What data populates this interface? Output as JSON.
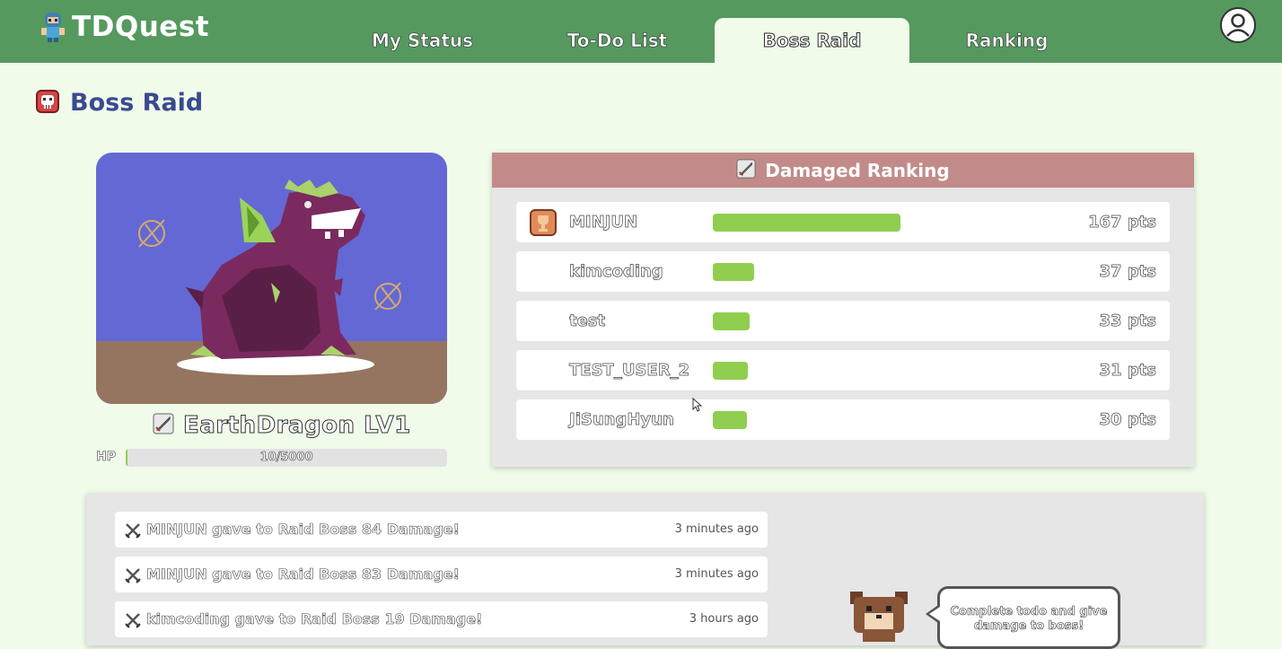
{
  "app": {
    "name": "TDQuest",
    "colors": {
      "topbar": "#55995f",
      "background": "#f0fbea",
      "accent_green": "#8fce4f",
      "title_blue": "#3a4a8f",
      "ranking_header": "#c28b89"
    }
  },
  "nav": {
    "tabs": [
      {
        "label": "My Status"
      },
      {
        "label": "To-Do List"
      },
      {
        "label": "Boss Raid",
        "active": true
      },
      {
        "label": "Ranking"
      }
    ]
  },
  "page": {
    "title": "Boss Raid",
    "icon": "skull-icon"
  },
  "boss": {
    "name": "EarthDragon LV1",
    "hp_label": "HP",
    "hp_text": "10/5000",
    "hp_fraction": 0.002
  },
  "ranking": {
    "title": "Damaged Ranking",
    "max_points": 167,
    "rows": [
      {
        "name": "MINJUN",
        "points_text": "167 pts",
        "points": 167,
        "trophy": true
      },
      {
        "name": "kimcoding",
        "points_text": "37 pts",
        "points": 37
      },
      {
        "name": "test",
        "points_text": "33 pts",
        "points": 33
      },
      {
        "name": "TEST_USER_2",
        "points_text": "31 pts",
        "points": 31
      },
      {
        "name": "JiSungHyun",
        "points_text": "30 pts",
        "points": 30
      }
    ]
  },
  "log": {
    "entries": [
      {
        "text": "MINJUN gave to Raid Boss 84 Damage!",
        "time": "3 minutes ago"
      },
      {
        "text": "MINJUN gave to Raid Boss 83 Damage!",
        "time": "3 minutes ago"
      },
      {
        "text": "kimcoding gave to Raid Boss 19 Damage!",
        "time": "3 hours ago"
      }
    ]
  },
  "speech": {
    "text": "Complete todo and give damage to boss!"
  }
}
